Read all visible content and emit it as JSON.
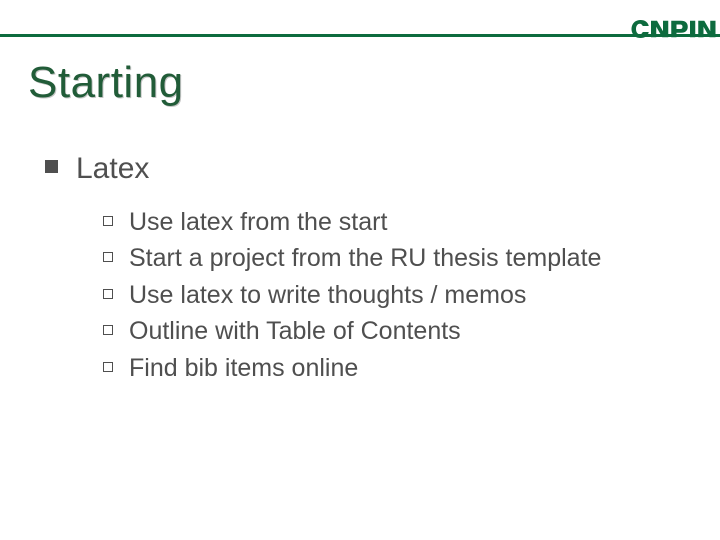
{
  "brand": {
    "name_text": "cnpin",
    "accent_color": "#0d6b3e"
  },
  "slide": {
    "title": "Starting",
    "items": [
      {
        "label": "Latex",
        "children": [
          {
            "label": "Use latex from the start"
          },
          {
            "label": "Start a project from the RU thesis template"
          },
          {
            "label": "Use latex to write thoughts / memos"
          },
          {
            "label": "Outline with Table of Contents"
          },
          {
            "label": "Find bib items online"
          }
        ]
      }
    ]
  }
}
